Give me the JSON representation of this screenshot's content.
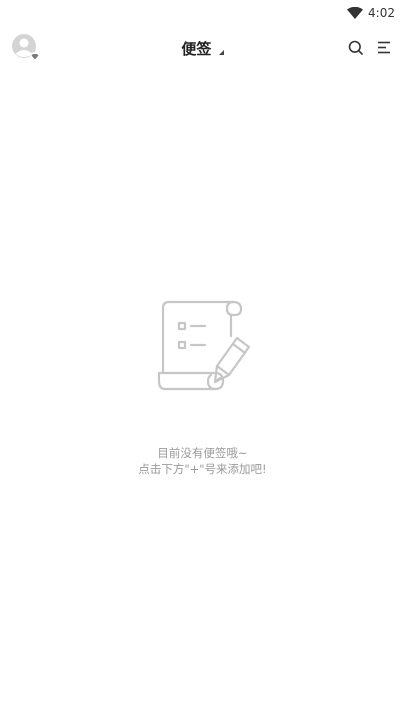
{
  "status_bar": {
    "time": "4:02",
    "wifi_icon": "wifi-icon"
  },
  "header": {
    "avatar_icon": "avatar-icon",
    "title": "便签",
    "search_icon": "search-icon",
    "menu_icon": "menu-icon"
  },
  "empty_state": {
    "illustration_icon": "note-scroll-with-pencil-icon",
    "line1": "目前没有便签哦~",
    "line2": "点击下方\"+\"号来添加吧!"
  },
  "colors": {
    "background": "#ffffff",
    "hint_text": "#9a9a9a",
    "icon_gray": "#c8c8c8"
  }
}
